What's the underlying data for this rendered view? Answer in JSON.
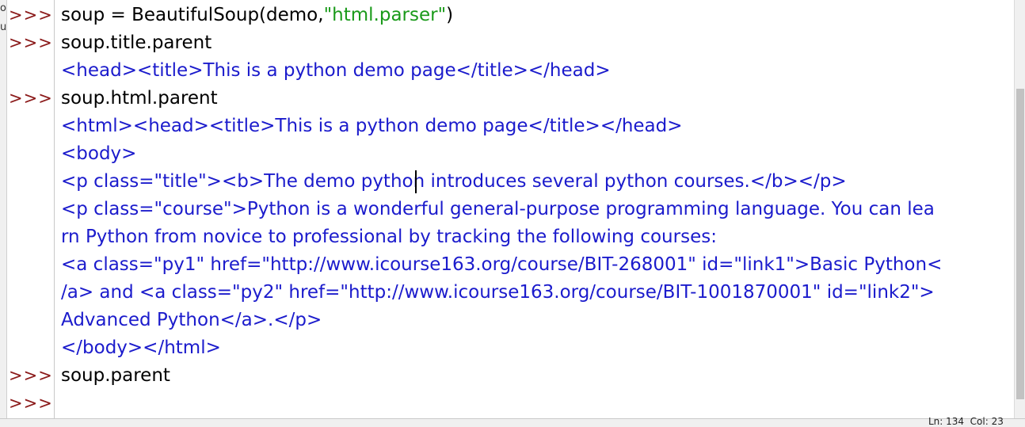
{
  "left_strip": {
    "frag1": "o",
    "frag2": "u"
  },
  "prompts": [
    ">>>",
    ">>>",
    ">>>",
    ">>>",
    ">>>"
  ],
  "shell": {
    "line1": "soup = BeautifulSoup(demo,",
    "line1_str": "\"html.parser\"",
    "line1_end": ")",
    "line2": "soup.title.parent",
    "line3": "<head><title>This is a python demo page</title></head>",
    "line4": "soup.html.parent",
    "line5": "<html><head><title>This is a python demo page</title></head>",
    "line6": "<body>",
    "line7": "<p class=\"title\"><b>The demo python introduces several python courses.</b></p>",
    "line8": "<p class=\"course\">Python is a wonderful general-purpose programming language. You can lea",
    "line9": "rn Python from novice to professional by tracking the following courses:",
    "line10": "<a class=\"py1\" href=\"http://www.icourse163.org/course/BIT-268001\" id=\"link1\">Basic Python<",
    "line11": "/a> and <a class=\"py2\" href=\"http://www.icourse163.org/course/BIT-1001870001\" id=\"link2\">",
    "line12": "Advanced Python</a>.</p>",
    "line13": "</body></html>",
    "line14": "soup.parent"
  },
  "status": {
    "text": "Ln: 134  Col: 23"
  },
  "colors": {
    "prompt": "#8b1a1a",
    "output": "#1b1bcc",
    "string": "#1a9a1a",
    "input": "#000000"
  }
}
